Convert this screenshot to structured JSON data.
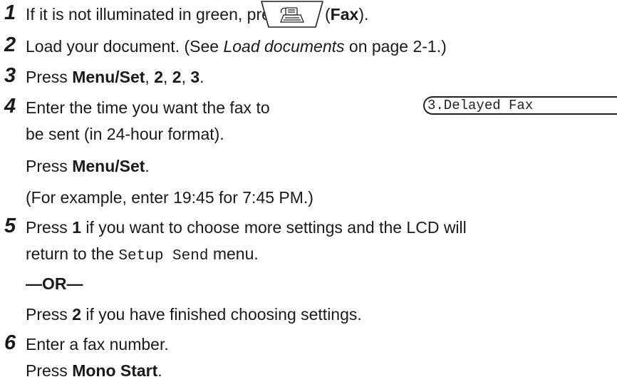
{
  "steps": [
    {
      "number": "1",
      "text_before": "If it is not illuminated in green, press",
      "paren_open": " (",
      "key": "Fax",
      "paren_close": ")."
    },
    {
      "number": "2",
      "text_before": "Load your document. (See ",
      "ref": "Load documents",
      "text_after": " on page 2-1.)"
    },
    {
      "number": "3",
      "text_before": "Press ",
      "b1": "Menu/Set",
      "s1": ", ",
      "b2": "2",
      "s2": ", ",
      "b3": "2",
      "s3": ", ",
      "b4": "3",
      "s4": "."
    },
    {
      "number": "4",
      "line1": "Enter the time you want the fax to",
      "line2": "be sent (in 24-hour format).",
      "press": "Press ",
      "key": "Menu/Set",
      "end": ".",
      "example": "(For example, enter 19:45 for 7:45 PM.)"
    },
    {
      "number": "5",
      "p1": "Press ",
      "key1": "1",
      "t1": " if you want to choose more settings and the LCD will",
      "t2": "return to the ",
      "menu": "Setup Send",
      "t3": " menu.",
      "or": "—OR—",
      "p2": "Press ",
      "key2": "2",
      "t4": " if you have finished choosing settings."
    },
    {
      "number": "6",
      "line1": "Enter a fax number.",
      "press": "Press ",
      "key": "Mono Start",
      "end": "."
    }
  ],
  "lcd_display": "3.Delayed Fax",
  "fax_key_icon": "fax-machine-icon"
}
